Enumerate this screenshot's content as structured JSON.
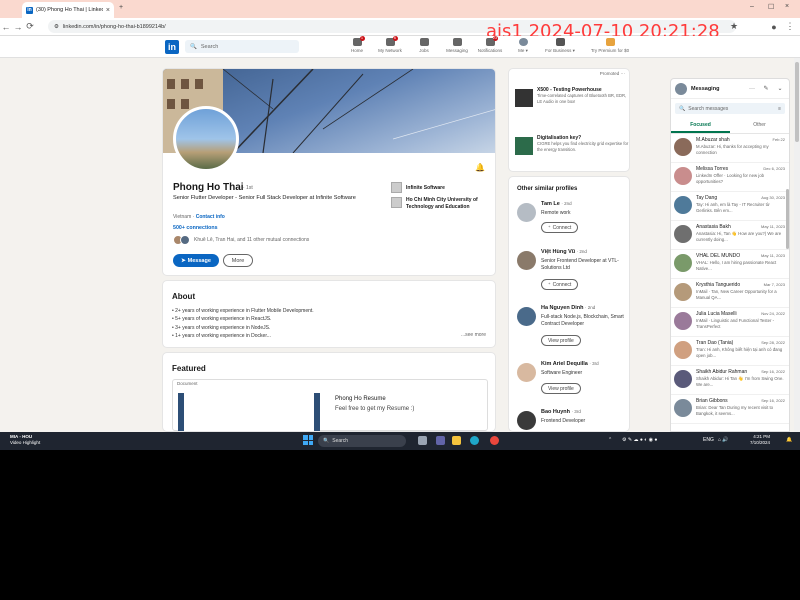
{
  "browser": {
    "tab_title": "(30) Phong Ho Thai | LinkedIn",
    "url": "linkedin.com/in/phong-ho-thai-b1899214b/"
  },
  "watermark": "ajs1 2024-07-10 20:21:28",
  "nav": {
    "logo": "in",
    "search_placeholder": "Search",
    "items": [
      {
        "label": "Home",
        "icon": "home-icon",
        "badge": "1"
      },
      {
        "label": "My Network",
        "icon": "network-icon",
        "badge": "6"
      },
      {
        "label": "Jobs",
        "icon": "jobs-icon",
        "badge": ""
      },
      {
        "label": "Messaging",
        "icon": "messaging-icon",
        "badge": ""
      },
      {
        "label": "Notifications",
        "icon": "bell-icon",
        "badge": "23"
      },
      {
        "label": "Me ▾",
        "icon": "avatar-icon",
        "badge": ""
      },
      {
        "label": "For Business ▾",
        "icon": "grid-icon",
        "badge": ""
      },
      {
        "label": "Try Premium for $0",
        "icon": "premium-icon",
        "badge": ""
      }
    ]
  },
  "profile": {
    "name": "Phong Ho Thai",
    "degree": "· 1st",
    "headline": "Senior Flutter Developer - Senior Full Stack Developer at Infinite Software",
    "location": "Vietnam ·",
    "contact_info": "Contact info",
    "connections": "500+ connections",
    "mutual": "Khuê Lê, Tran Hai, and 11 other mutual connections",
    "message_btn": "Message",
    "more_btn": "More",
    "experience": [
      {
        "name": "Infinite Software"
      },
      {
        "name": "Ho Chi Minh City University of Technology and Education"
      }
    ]
  },
  "about": {
    "title": "About",
    "lines": [
      "• 2+ years of working experience in Flutter Mobile Development.",
      "• 5+ years of working experience in ReactJS.",
      "• 3+ years of working experience in NodeJS.",
      "• 1+ years of working experience in Docker..."
    ],
    "see_more": "...see more"
  },
  "featured": {
    "title": "Featured",
    "item_type": "Document",
    "item_title": "Phong Ho Resume",
    "item_desc": "Feel free to get my Resume :)"
  },
  "ads": {
    "promoted": "Promoted ···",
    "items": [
      {
        "title": "X500 - Testing Powerhouse",
        "desc": "Time-correlated captures of Bluetooth BR, EDR, LE Audio in one box!"
      },
      {
        "title": "Digitalisation key?",
        "desc": "CIGRE helps you find electricity grid expertise for the energy transition."
      }
    ]
  },
  "similar": {
    "title": "Other similar profiles",
    "people": [
      {
        "name": "Tam Le",
        "degree": "· 2nd",
        "desc": "Remote work",
        "button": "Connect"
      },
      {
        "name": "Việt Hùng Vũ",
        "degree": "· 2nd",
        "desc": "Senior Frontend Developer at VTL-Solutions Ltd",
        "button": "Connect"
      },
      {
        "name": "Ha Nguyen Dinh",
        "degree": "· 2nd",
        "desc": "Full-stack Node.js, Blockchain, Smart Contract Developer",
        "button": "View profile"
      },
      {
        "name": "Kim Ariel Dequilla",
        "degree": "· 3rd",
        "desc": "Software Engineer",
        "button": "View profile"
      },
      {
        "name": "Bao Huynh",
        "degree": "· 3rd",
        "desc": "Frontend Developer",
        "button": ""
      }
    ]
  },
  "messaging": {
    "title": "Messaging",
    "search_placeholder": "Search messages",
    "tabs": [
      "Focused",
      "Other"
    ],
    "conversations": [
      {
        "name": "M.Abuzar shah",
        "date": "Feb 22",
        "preview": "M.Abuzar: Hi, thanks for accepting my connection"
      },
      {
        "name": "Melissa Torres",
        "date": "Dec 6, 2023",
        "preview": "LinkedIn Offer · Looking for new job opportunities?"
      },
      {
        "name": "Tay Dang",
        "date": "Aug 30, 2023",
        "preview": "Tay: Hi anh, em là Tay - IT Recruiter từ Gerlinks. Bên em..."
      },
      {
        "name": "Anastasia Bakh",
        "date": "May 11, 2023",
        "preview": "Anastasia: Hi, Tan 👋 How are you?) We are currently doing..."
      },
      {
        "name": "VHAL DEL MUNDO",
        "date": "May 11, 2023",
        "preview": "VHAL: Hello, I am hiring passionate React Native..."
      },
      {
        "name": "Krysthia Tanguerido",
        "date": "Mar 7, 2023",
        "preview": "InMail · Tan, New Career Opportunity for a Manual QA..."
      },
      {
        "name": "Julia Lucia Maselli",
        "date": "Nov 24, 2022",
        "preview": "InMail · Linguistic and Functional Tester - TransPerfect"
      },
      {
        "name": "Tran Dao (Tania)",
        "date": "Sep 28, 2022",
        "preview": "Tran: Hi anh, Không biết hiện tại anh có đang open job..."
      },
      {
        "name": "Shaikh Abidur Rahman",
        "date": "Sep 16, 2022",
        "preview": "Shaikh Abidur: Hi Tan 👋 I'm from Swing One. We are..."
      },
      {
        "name": "Brian Gibbons",
        "date": "Sep 16, 2022",
        "preview": "Brian: Dear Tan During my recent visit to Bangkok, it seems..."
      }
    ]
  },
  "taskbar": {
    "weather_title": "MIA - HOU",
    "weather_sub": "Video Highlight",
    "search": "Search",
    "lang": "ENG",
    "time": "4:21 PM",
    "date": "7/10/2024"
  }
}
